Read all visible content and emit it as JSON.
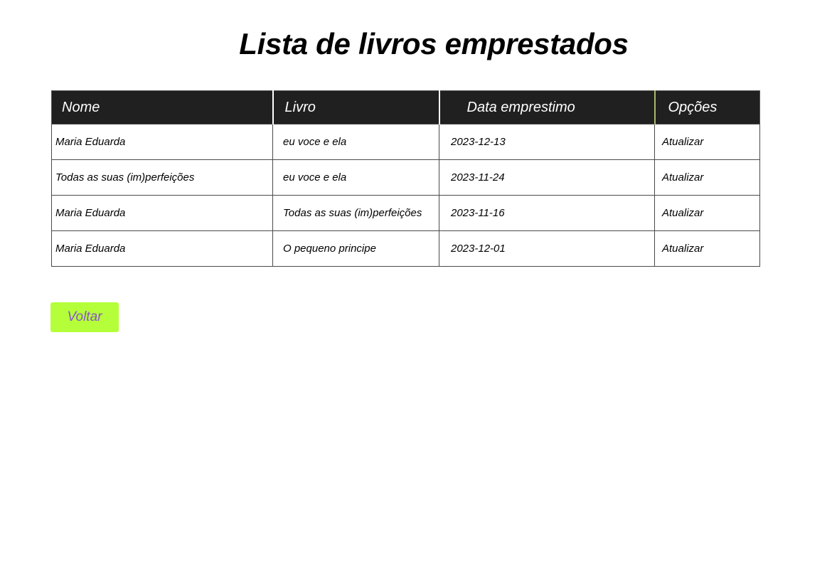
{
  "page": {
    "title": "Lista de livros emprestados"
  },
  "table": {
    "headers": {
      "nome": "Nome",
      "livro": "Livro",
      "data": "Data emprestimo",
      "opcoes": "Opções"
    },
    "rows": [
      {
        "nome": "Maria Eduarda",
        "livro": "eu voce e ela",
        "data": "2023-12-13",
        "acao": "Atualizar"
      },
      {
        "nome": "Todas as suas (im)perfeições",
        "livro": "eu voce e ela",
        "data": "2023-11-24",
        "acao": "Atualizar"
      },
      {
        "nome": "Maria Eduarda",
        "livro": "Todas as suas (im)perfeições",
        "data": "2023-11-16",
        "acao": "Atualizar"
      },
      {
        "nome": "Maria Eduarda",
        "livro": "O pequeno principe",
        "data": "2023-12-01",
        "acao": "Atualizar"
      }
    ]
  },
  "actions": {
    "back_label": "Voltar"
  },
  "colors": {
    "header_background": "#202020",
    "back_button_background": "#b4ff3a",
    "back_button_text": "#8a55c8"
  }
}
